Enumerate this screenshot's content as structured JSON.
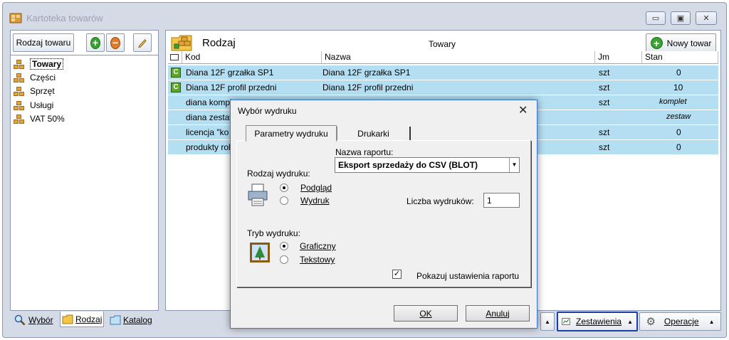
{
  "window": {
    "title": "Kartoteka towarów"
  },
  "left_panel": {
    "type_button": "Rodzaj towaru",
    "tree": [
      {
        "label": "Towary",
        "selected": true
      },
      {
        "label": "Części"
      },
      {
        "label": "Sprzęt"
      },
      {
        "label": "Usługi"
      },
      {
        "label": "VAT 50%"
      }
    ],
    "tabs": {
      "wybor": "Wybór",
      "rodzaj": "Rodzaj",
      "katalog": "Katalog"
    }
  },
  "main": {
    "header_title": "Rodzaj",
    "grid_title": "Towary",
    "new_button": "Nowy towar",
    "columns": {
      "kod": "Kod",
      "nazwa": "Nazwa",
      "jm": "Jm",
      "stan": "Stan"
    },
    "rows": [
      {
        "badge": "C",
        "kod": "Diana 12F grzałka SP1",
        "nazwa": "Diana 12F grzałka SP1",
        "jm": "szt",
        "stan": "0"
      },
      {
        "badge": "C",
        "kod": "Diana 12F profil przedni",
        "nazwa": "Diana 12F profil przedni",
        "jm": "szt",
        "stan": "10"
      },
      {
        "badge": "",
        "kod": "diana kompl",
        "nazwa": "",
        "jm": "szt",
        "stan": "komplet"
      },
      {
        "badge": "",
        "kod": "diana zestaw",
        "nazwa": "",
        "jm": "",
        "stan": "zestaw"
      },
      {
        "badge": "",
        "kod": "licencja \"ko",
        "nazwa": "",
        "jm": "szt",
        "stan": "0"
      },
      {
        "badge": "",
        "kod": "produkty roln",
        "nazwa": "",
        "jm": "szt",
        "stan": "0"
      }
    ],
    "bottom_buttons": {
      "zestawienia": "Zestawienia",
      "operacje": "Operacje"
    }
  },
  "dialog": {
    "title": "Wybór wydruku",
    "tabs": {
      "parametry": "Parametry wydruku",
      "drukarki": "Drukarki"
    },
    "report_name_label": "Nazwa raportu:",
    "report_name_value": "Eksport sprzedaży do CSV (BLOT)",
    "print_type_label": "Rodzaj wydruku:",
    "print_type_options": {
      "podglad": "Podgląd",
      "wydruk": "Wydruk"
    },
    "copies_label": "Liczba wydruków:",
    "copies_value": "1",
    "mode_label": "Tryb wydruku:",
    "mode_options": {
      "graficzny": "Graficzny",
      "tekstowy": "Tekstowy"
    },
    "show_settings_label": "Pokazuj ustawienia raportu",
    "show_settings_checked": true,
    "ok": "OK",
    "cancel": "Anuluj"
  }
}
